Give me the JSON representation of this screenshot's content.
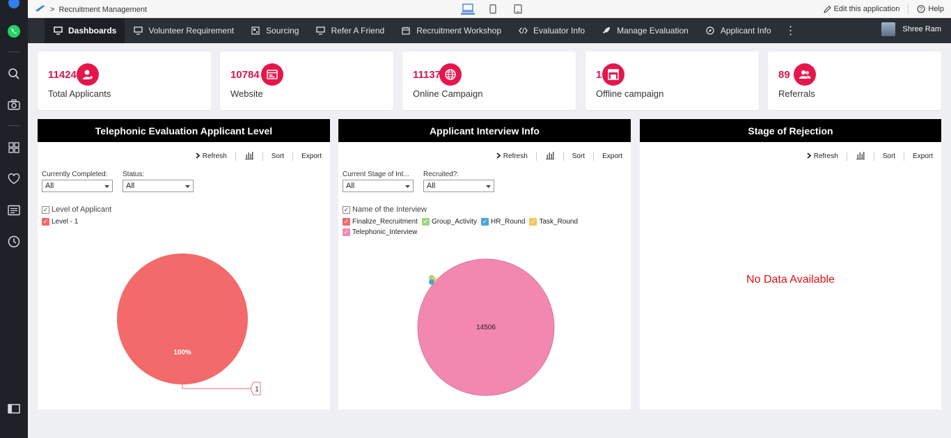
{
  "topbar": {
    "breadcrumb_sep": ">",
    "app_name": "Recruitment Management",
    "edit_label": "Edit this application",
    "help_label": "Help"
  },
  "nav": {
    "items": [
      {
        "label": "Dashboards",
        "icon": "monitor-icon",
        "active": true
      },
      {
        "label": "Volunteer Requirement",
        "icon": "monitor-icon"
      },
      {
        "label": "Sourcing",
        "icon": "grid-image-icon"
      },
      {
        "label": "Refer A Friend",
        "icon": "monitor-icon"
      },
      {
        "label": "Recruitment Workshop",
        "icon": "calendar-icon"
      },
      {
        "label": "Evaluator Info",
        "icon": "code-icon"
      },
      {
        "label": "Manage Evaluation",
        "icon": "rocket-icon"
      },
      {
        "label": "Applicant Info",
        "icon": "compass-icon"
      }
    ],
    "more": "⋮",
    "user_name": "Shree Ram"
  },
  "kpis": [
    {
      "value": "11424",
      "label": "Total Applicants",
      "icon": "user-star-icon"
    },
    {
      "value": "10784",
      "label": "Website",
      "icon": "browser-icon"
    },
    {
      "value": "11137",
      "label": "Online Campaign",
      "icon": "globe-icon"
    },
    {
      "value": "1",
      "label": "Offline campaign",
      "icon": "layout-icon"
    },
    {
      "value": "89",
      "label": "Referrals",
      "icon": "users-icon"
    }
  ],
  "toolbar": {
    "refresh": "Refresh",
    "sort": "Sort",
    "export": "Export"
  },
  "panels": {
    "telephonic": {
      "title": "Telephonic Evaluation Applicant Level",
      "filter1_label": "Currently Completed:",
      "filter1_value": "All",
      "filter2_label": "Status:",
      "filter2_value": "All",
      "legend_title": "Level of Applicant",
      "legend": [
        {
          "label": "Level - 1",
          "color": "#f26a6a"
        }
      ]
    },
    "interview": {
      "title": "Applicant Interview Info",
      "filter1_label": "Current Stage of Int...",
      "filter1_value": "All",
      "filter2_label": "Recruited?:",
      "filter2_value": "All",
      "legend_title": "Name of the Interview",
      "legend": [
        {
          "label": "Finalize_Recruitment",
          "color": "#f26a6a"
        },
        {
          "label": "Group_Activity",
          "color": "#9fd67a"
        },
        {
          "label": "HR_Round",
          "color": "#4aa3df"
        },
        {
          "label": "Task_Round",
          "color": "#f4c95a"
        },
        {
          "label": "Telephonic_Interview",
          "color": "#f288b0"
        }
      ]
    },
    "rejection": {
      "title": "Stage of Rejection",
      "no_data": "No Data Available"
    }
  },
  "chart_data": [
    {
      "type": "pie",
      "categories": [
        "Level - 1"
      ],
      "values": [
        1
      ],
      "labels": [
        "100%"
      ],
      "callouts": [
        "1"
      ],
      "colors": [
        "#f26a6a"
      ]
    },
    {
      "type": "pie",
      "categories": [
        "Finalize_Recruitment",
        "Group_Activity",
        "HR_Round",
        "Task_Round",
        "Telephonic_Interview"
      ],
      "values": [
        null,
        null,
        null,
        null,
        14506
      ],
      "labels": [
        "14506"
      ],
      "colors": [
        "#f26a6a",
        "#9fd67a",
        "#4aa3df",
        "#f4c95a",
        "#f288b0"
      ]
    }
  ]
}
